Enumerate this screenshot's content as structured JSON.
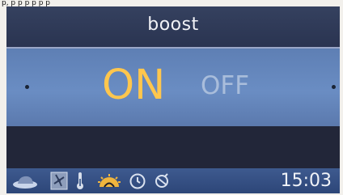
{
  "page_top_text": "p, p p p p p p",
  "display": {
    "title": "boost",
    "options": {
      "selected": "ON",
      "alternative": "OFF"
    },
    "status_bar": {
      "icons": [
        "seat-icon",
        "fan-icon",
        "thermometer-icon",
        "sun-icon",
        "timer-icon",
        "temperature-icon"
      ],
      "clock": "15:03"
    },
    "colors": {
      "selected_option": "#ffc64d",
      "unselected_option": "#a9bddb",
      "selection_band": "#6a8dc3",
      "title_bar": "#35415f",
      "status_bar": "#3e5a8f"
    }
  }
}
